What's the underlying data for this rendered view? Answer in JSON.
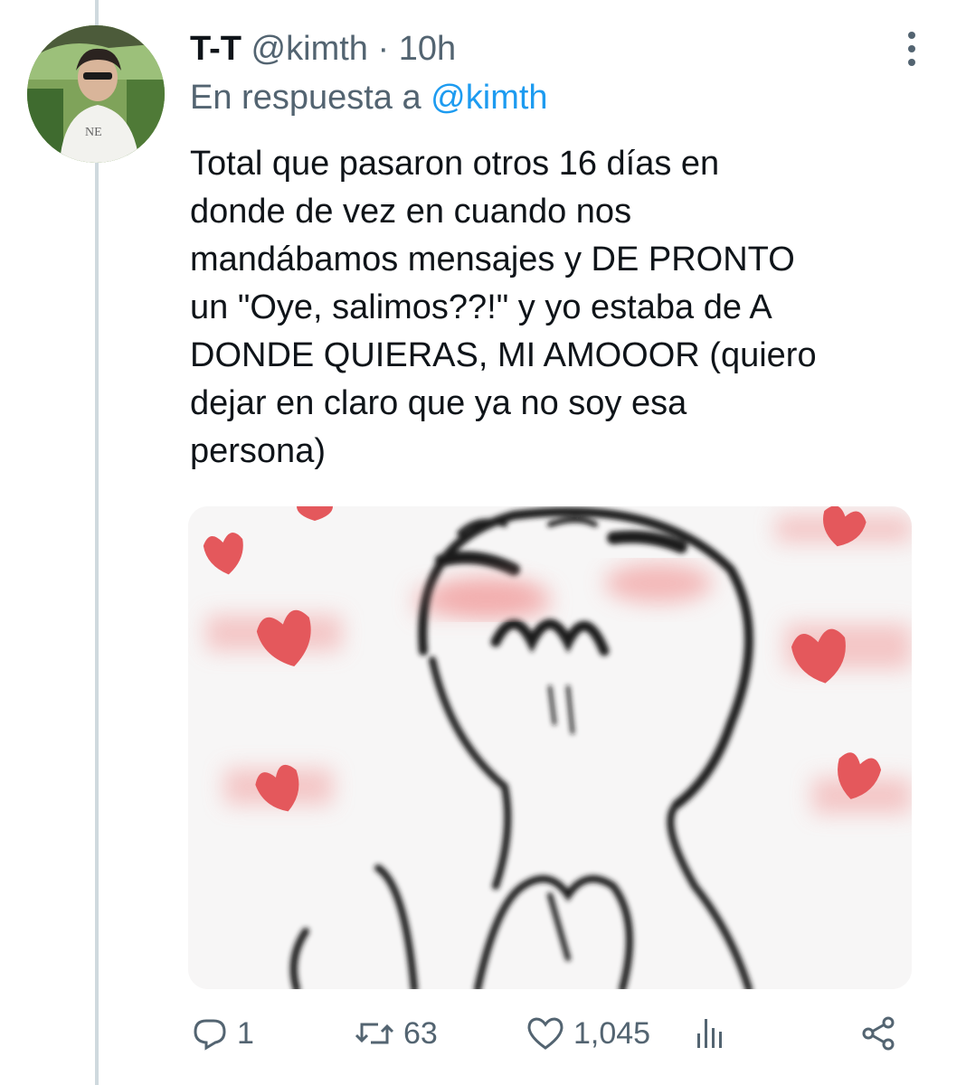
{
  "tweet": {
    "display_name": "T-T",
    "handle": "@kimth",
    "separator": "·",
    "time": "10h",
    "reply_prefix": "En respuesta a",
    "reply_mention": "@kimth",
    "text": "Total que pasaron otros 16 días en\ndonde de vez en cuando nos\nmandábamos mensajes y DE PRONTO\nun \"Oye, salimos??!\" y yo estaba de A\nDONDE QUIERAS, MI AMOOOR (quiero\ndejar en claro que ya no soy esa\npersona)"
  },
  "actions": {
    "replies": "1",
    "retweets": "63",
    "likes": "1,045"
  },
  "icons": {
    "more": "more-options-icon",
    "reply": "reply-icon",
    "retweet": "retweet-icon",
    "like": "heart-icon",
    "views": "analytics-icon",
    "share": "share-icon"
  },
  "colors": {
    "text": "#0f1419",
    "secondary": "#536471",
    "link": "#1d9bf0",
    "thread_line": "#cfd9de",
    "hearts": "#e4585c"
  }
}
